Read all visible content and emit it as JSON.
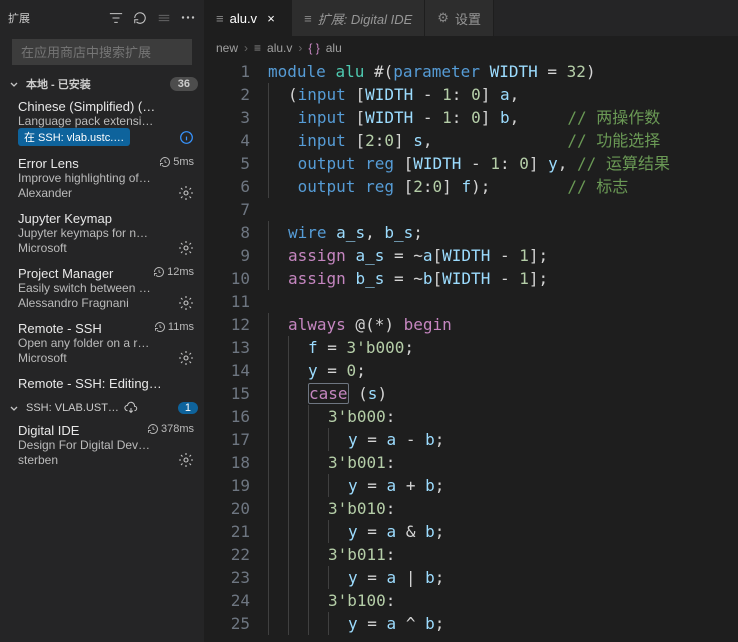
{
  "sidebar": {
    "title": "扩展",
    "searchPlaceholder": "在应用商店中搜索扩展",
    "section": {
      "label": "本地 - 已安装",
      "count": "36"
    },
    "sshSection": {
      "label": "SSH: VLAB.UST…",
      "count": "1"
    },
    "exts": [
      {
        "name": "Chinese (Simplified) (…",
        "desc": "Language pack extensi…",
        "author": "",
        "ssh": "在 SSH: vlab.ustc.…",
        "info": true
      },
      {
        "name": "Error Lens",
        "desc": "Improve highlighting of…",
        "author": "Alexander",
        "time": "5ms"
      },
      {
        "name": "Jupyter Keymap",
        "desc": "Jupyter keymaps for n…",
        "author": "Microsoft"
      },
      {
        "name": "Project Manager",
        "desc": "Easily switch between …",
        "author": "Alessandro Fragnani",
        "time": "12ms"
      },
      {
        "name": "Remote - SSH",
        "desc": "Open any folder on a r…",
        "author": "Microsoft",
        "time": "11ms"
      },
      {
        "name": "Remote - SSH: Editing…",
        "desc": "",
        "author": ""
      }
    ],
    "sshExts": [
      {
        "name": "Digital IDE",
        "desc": "Design For Digital Dev…",
        "author": "sterben",
        "time": "378ms"
      }
    ]
  },
  "tabs": [
    {
      "label": "alu.v",
      "active": true,
      "icon": "verilog"
    },
    {
      "label": "扩展: Digital IDE",
      "active": false,
      "italic": true,
      "icon": "ext"
    },
    {
      "label": "设置",
      "active": false,
      "icon": "gear"
    }
  ],
  "breadcrumbs": {
    "p1": "new",
    "p2": "alu.v",
    "p3": "alu"
  },
  "code": {
    "lines": [
      "module alu #(parameter WIDTH = 32)",
      "    (input [WIDTH - 1: 0] a,",
      "     input [WIDTH - 1: 0] b,     // 两操作数",
      "     input [2:0] s,              // 功能选择",
      "     output reg [WIDTH - 1: 0] y, // 运算结果",
      "     output reg [2:0] f);        // 标志",
      "",
      "    wire a_s, b_s;",
      "    assign a_s = ~a[WIDTH - 1];",
      "    assign b_s = ~b[WIDTH - 1];",
      "",
      "    always @(*) begin",
      "        f = 3'b000;",
      "        y = 0;",
      "        case (s)",
      "            3'b000:",
      "                y = a - b;",
      "            3'b001:",
      "                y = a + b;",
      "            3'b010:",
      "                y = a & b;",
      "            3'b011:",
      "                y = a | b;",
      "            3'b100:",
      "                y = a ^ b;"
    ]
  }
}
